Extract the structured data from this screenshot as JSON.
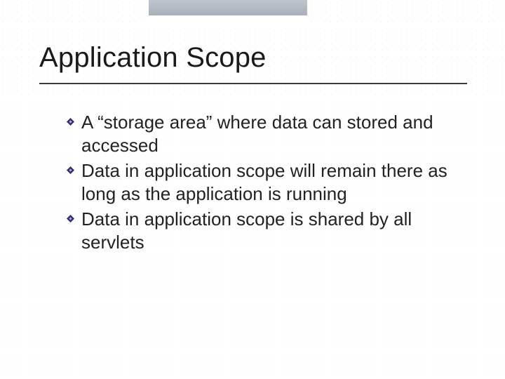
{
  "title": "Application Scope",
  "bullets": {
    "items": [
      "A “storage area” where data can stored and accessed",
      "Data in application scope will remain there as long as the application is running",
      "Data in application scope is shared by all servlets"
    ]
  }
}
